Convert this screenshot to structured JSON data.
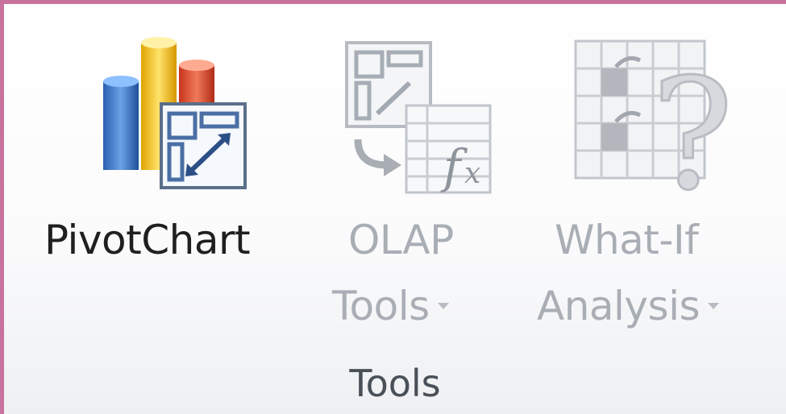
{
  "ribbon": {
    "group_name": "Tools",
    "commands": [
      {
        "id": "pivotchart",
        "label": "PivotChart",
        "icon": "pivotchart-icon",
        "enabled": true
      },
      {
        "id": "olap-tools",
        "label_line1": "OLAP",
        "label_line2": "Tools",
        "icon": "olap-tools-icon",
        "enabled": false,
        "has_dropdown": true
      },
      {
        "id": "what-if",
        "label_line1": "What-If",
        "label_line2": "Analysis",
        "icon": "what-if-analysis-icon",
        "enabled": false,
        "has_dropdown": true
      }
    ]
  },
  "colors": {
    "accent_border": "#c8739e",
    "disabled_text": "#a9aeb5",
    "enabled_text": "#1f1f1f"
  }
}
